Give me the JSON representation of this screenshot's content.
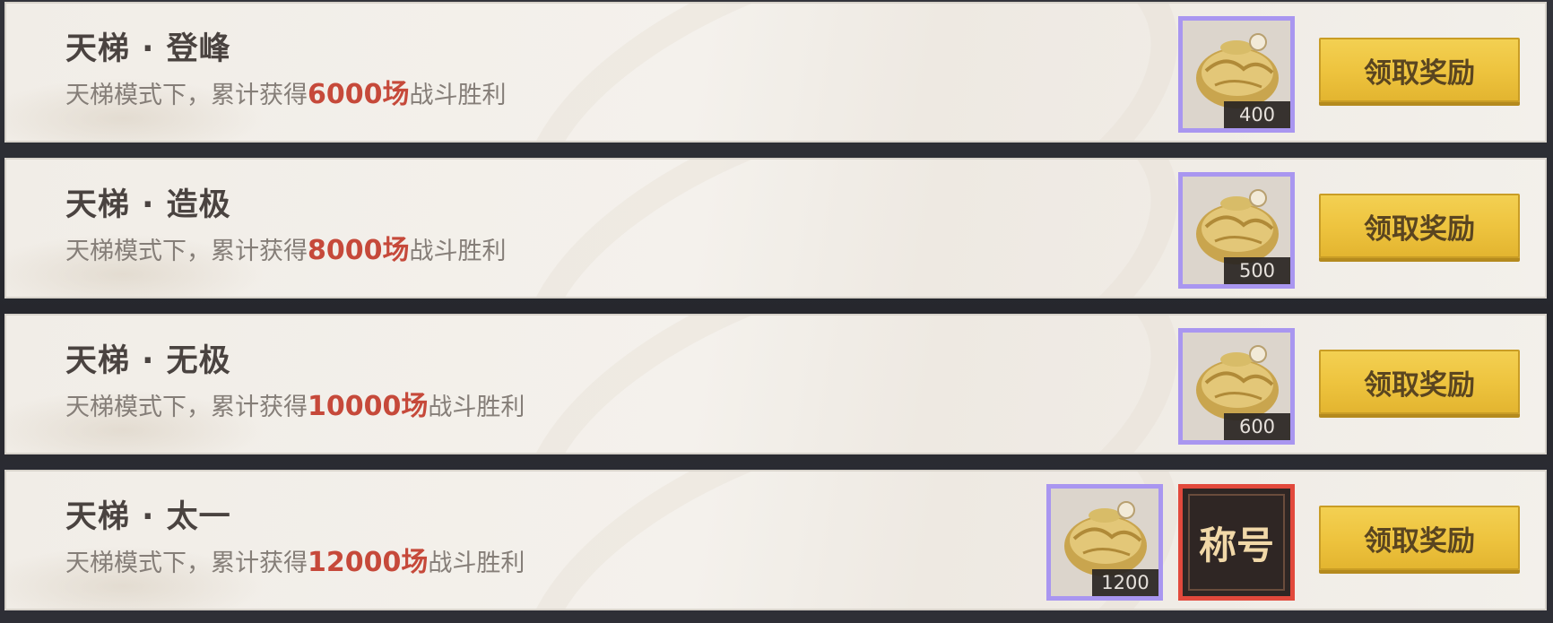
{
  "achievements": [
    {
      "title": "天梯 · 登峰",
      "desc_prefix": "天梯模式下，累计获得",
      "desc_highlight": "6000场",
      "desc_suffix": "战斗胜利",
      "rewards": [
        {
          "type": "pouch",
          "qty": "400"
        }
      ],
      "button": "领取奖励"
    },
    {
      "title": "天梯 · 造极",
      "desc_prefix": "天梯模式下，累计获得",
      "desc_highlight": "8000场",
      "desc_suffix": "战斗胜利",
      "rewards": [
        {
          "type": "pouch",
          "qty": "500"
        }
      ],
      "button": "领取奖励"
    },
    {
      "title": "天梯 · 无极",
      "desc_prefix": "天梯模式下，累计获得",
      "desc_highlight": "10000场",
      "desc_suffix": "战斗胜利",
      "rewards": [
        {
          "type": "pouch",
          "qty": "600"
        }
      ],
      "button": "领取奖励"
    },
    {
      "title": "天梯 · 太一",
      "desc_prefix": "天梯模式下，累计获得",
      "desc_highlight": "12000场",
      "desc_suffix": "战斗胜利",
      "rewards": [
        {
          "type": "pouch",
          "qty": "1200"
        },
        {
          "type": "title_badge",
          "label": "称号"
        }
      ],
      "button": "领取奖励"
    }
  ],
  "colors": {
    "highlight": "#c6493a",
    "item_border": "#a996f0",
    "title_badge_border": "#e2493c",
    "button": "#eec43f"
  }
}
